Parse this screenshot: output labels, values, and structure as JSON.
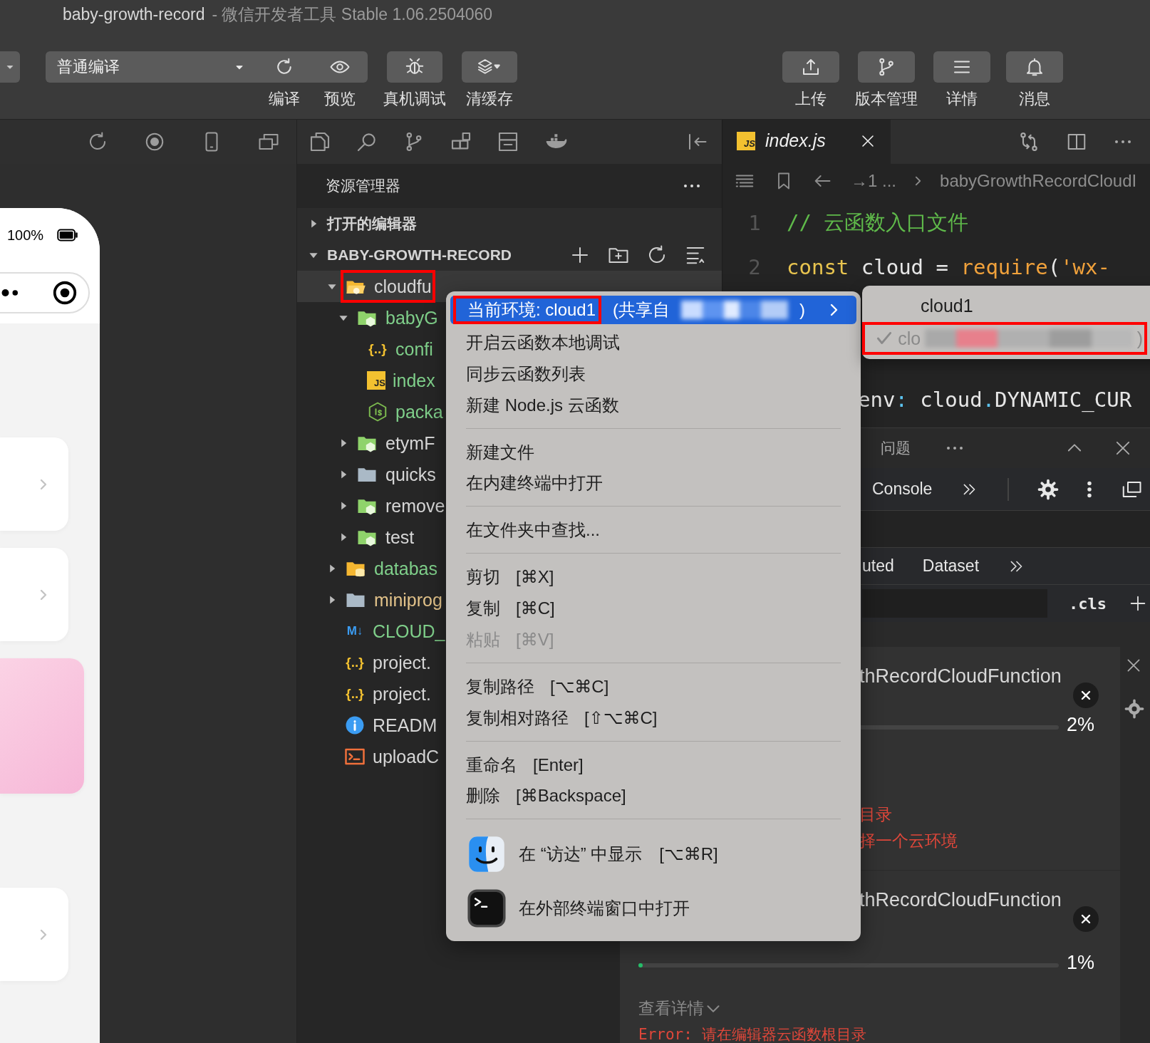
{
  "window": {
    "title": "baby-growth-record",
    "subtitle": "- 微信开发者工具 Stable 1.06.2504060"
  },
  "toolbar": {
    "compile_mode": "普通编译",
    "left_buttons": [
      {
        "kind": "compile",
        "label": "编译"
      },
      {
        "kind": "preview",
        "label": "预览"
      },
      {
        "kind": "debug",
        "label": "真机调试"
      },
      {
        "kind": "cache",
        "label": "清缓存"
      }
    ],
    "right_buttons": [
      {
        "kind": "upload",
        "label": "上传"
      },
      {
        "kind": "version",
        "label": "版本管理"
      },
      {
        "kind": "details",
        "label": "详情"
      },
      {
        "kind": "messages",
        "label": "消息"
      }
    ]
  },
  "simulator": {
    "battery": "100%",
    "cards": [
      {
        "kind": "plain"
      },
      {
        "kind": "plain"
      },
      {
        "kind": "pink"
      },
      {
        "kind": "plain"
      }
    ]
  },
  "explorer": {
    "title": "资源管理器",
    "sections": [
      {
        "label": "打开的编辑器",
        "expanded": false
      },
      {
        "label": "BABY-GROWTH-RECORD",
        "expanded": true
      }
    ],
    "tree": [
      {
        "name": "cloudfu",
        "kind": "cloud-folder",
        "untracked": false,
        "modified": false,
        "expanded": true,
        "selected": true,
        "highlighted": true,
        "children": [
          {
            "name": "babyG",
            "kind": "function-folder",
            "untracked": true,
            "modified": false,
            "expanded": true,
            "selected": false,
            "highlighted": false,
            "children": [
              {
                "name": "confi",
                "kind": "json",
                "glyph": "{..}",
                "untracked": true,
                "modified": false,
                "selected": false,
                "highlighted": false
              },
              {
                "name": "index",
                "kind": "js",
                "glyph": "JS",
                "untracked": true,
                "modified": false,
                "selected": false,
                "highlighted": false
              },
              {
                "name": "packa",
                "kind": "node",
                "untracked": true,
                "modified": false,
                "selected": false,
                "highlighted": false
              }
            ]
          },
          {
            "name": "etymF",
            "kind": "function-folder",
            "untracked": false,
            "modified": false,
            "expanded": false,
            "selected": false,
            "highlighted": false
          },
          {
            "name": "quicks",
            "kind": "folder",
            "untracked": false,
            "modified": false,
            "expanded": false,
            "selected": false,
            "highlighted": false
          },
          {
            "name": "remove",
            "kind": "function-folder",
            "untracked": false,
            "modified": false,
            "expanded": false,
            "selected": false,
            "highlighted": false
          },
          {
            "name": "test",
            "kind": "function-folder",
            "untracked": false,
            "modified": false,
            "expanded": false,
            "selected": false,
            "highlighted": false
          }
        ]
      },
      {
        "name": "databas",
        "kind": "db-folder",
        "untracked": true,
        "modified": false,
        "expanded": false,
        "selected": false,
        "highlighted": false
      },
      {
        "name": "miniprog",
        "kind": "folder",
        "untracked": false,
        "modified": true,
        "expanded": false,
        "selected": false,
        "highlighted": false
      },
      {
        "name": "CLOUD_",
        "kind": "markdown",
        "glyph": "M↓",
        "untracked": true,
        "modified": false,
        "selected": false,
        "highlighted": false
      },
      {
        "name": "project.",
        "kind": "json",
        "glyph": "{..}",
        "untracked": false,
        "modified": false,
        "selected": false,
        "highlighted": false
      },
      {
        "name": "project.",
        "kind": "json",
        "glyph": "{..}",
        "untracked": false,
        "modified": false,
        "selected": false,
        "highlighted": false
      },
      {
        "name": "READM",
        "kind": "info",
        "untracked": false,
        "modified": false,
        "selected": false,
        "highlighted": false
      },
      {
        "name": "uploadC",
        "kind": "shell",
        "untracked": false,
        "modified": false,
        "selected": false,
        "highlighted": false
      }
    ]
  },
  "editor": {
    "tab": {
      "label": "index.js",
      "glyph": "JS",
      "selected": true
    },
    "breadcrumb": [
      "→1 ...",
      "babyGrowthRecordCloudI"
    ],
    "code": [
      {
        "number": "1",
        "tokens": [
          {
            "kind": "comment",
            "text": "// 云函数入口文件"
          }
        ]
      },
      {
        "number": "2",
        "tokens": [
          {
            "kind": "keyword",
            "text": "const"
          },
          {
            "kind": "plain",
            "text": " cloud "
          },
          {
            "kind": "op",
            "text": "="
          },
          {
            "kind": "fn",
            "text": " require"
          },
          {
            "kind": "plain",
            "text": "("
          },
          {
            "kind": "string",
            "text": "'wx-"
          }
        ]
      },
      {
        "tokens": [
          {
            "kind": "plain",
            "text": "env"
          },
          {
            "kind": "punct",
            "text": ":"
          },
          {
            "kind": "plain",
            "text": " cloud"
          },
          {
            "kind": "punct",
            "text": "."
          },
          {
            "kind": "plain",
            "text": "DYNAMIC_CUR"
          }
        ]
      }
    ]
  },
  "panel": {
    "tabs": [
      {
        "label": "问题",
        "selected": false
      }
    ],
    "devtools_tabs": [
      {
        "label": "Console",
        "selected": false
      }
    ],
    "style_tabs": [
      {
        "label": "uted",
        "selected": false
      },
      {
        "label": "Dataset",
        "selected": false
      }
    ],
    "filter_hint": ".cls"
  },
  "context_menu": {
    "items": [
      {
        "kind": "submenu",
        "label": "当前环境: cloud1",
        "label_rest": "(共享自",
        "label_end": ")",
        "redacted": true,
        "selected": true,
        "disabled": false,
        "highlighted": true
      },
      {
        "kind": "item",
        "label": "开启云函数本地调试",
        "selected": false,
        "disabled": false
      },
      {
        "kind": "item",
        "label": "同步云函数列表",
        "selected": false,
        "disabled": false
      },
      {
        "kind": "item",
        "label": "新建 Node.js 云函数",
        "selected": false,
        "disabled": false
      },
      {
        "kind": "separator"
      },
      {
        "kind": "item",
        "label": "新建文件",
        "selected": false,
        "disabled": false
      },
      {
        "kind": "item",
        "label": "在内建终端中打开",
        "selected": false,
        "disabled": false
      },
      {
        "kind": "separator"
      },
      {
        "kind": "item",
        "label": "在文件夹中查找...",
        "selected": false,
        "disabled": false
      },
      {
        "kind": "separator"
      },
      {
        "kind": "item",
        "label": "剪切",
        "shortcut": "[⌘X]",
        "selected": false,
        "disabled": false
      },
      {
        "kind": "item",
        "label": "复制",
        "shortcut": "[⌘C]",
        "selected": false,
        "disabled": false
      },
      {
        "kind": "item",
        "label": "粘贴",
        "shortcut": "[⌘V]",
        "selected": false,
        "disabled": true
      },
      {
        "kind": "separator"
      },
      {
        "kind": "item",
        "label": "复制路径",
        "shortcut": "[⌥⌘C]",
        "selected": false,
        "disabled": false
      },
      {
        "kind": "item",
        "label": "复制相对路径",
        "shortcut": "[⇧⌥⌘C]",
        "selected": false,
        "disabled": false
      },
      {
        "kind": "separator"
      },
      {
        "kind": "item",
        "label": "重命名",
        "shortcut": "[Enter]",
        "selected": false,
        "disabled": false
      },
      {
        "kind": "item",
        "label": "删除",
        "shortcut": "[⌘Backspace]",
        "selected": false,
        "disabled": false
      },
      {
        "kind": "separator"
      },
      {
        "kind": "finder",
        "label": "在 “访达” 中显示",
        "shortcut": "[⌥⌘R]",
        "selected": false,
        "disabled": false
      },
      {
        "kind": "terminal",
        "label": "在外部终端窗口中打开",
        "selected": false,
        "disabled": false
      }
    ]
  },
  "submenu": {
    "items": [
      {
        "label": "cloud1",
        "checked": false,
        "disabled": false,
        "redacted": false,
        "highlighted": false
      },
      {
        "label": "clo",
        "label_end": ")",
        "checked": true,
        "disabled": true,
        "redacted": true,
        "highlighted": true
      }
    ]
  },
  "notifications": [
    {
      "title": "thRecordCloudFunction",
      "level": 0.02,
      "percent": "2%",
      "errors": [
        "目录",
        "择一个云环境"
      ]
    },
    {
      "title": "thRecordCloudFunction",
      "level": 0.01,
      "percent": "1%",
      "details": "查看详情",
      "error": "Error: 请在编辑器云函数根目录"
    }
  ]
}
